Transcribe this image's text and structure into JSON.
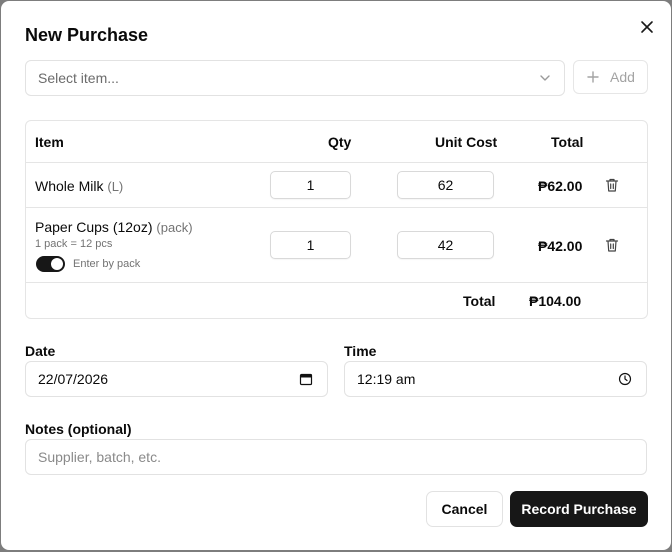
{
  "dialog": {
    "title": "New Purchase",
    "close_icon": "close-icon"
  },
  "item_select": {
    "placeholder": "Select item...",
    "add_label": "Add"
  },
  "table": {
    "headers": {
      "item": "Item",
      "qty": "Qty",
      "unit_cost": "Unit Cost",
      "total": "Total"
    },
    "rows": [
      {
        "name": "Whole Milk",
        "unit": "(L)",
        "qty": "1",
        "unit_cost": "62",
        "total": "₱62.00"
      },
      {
        "name": "Paper Cups (12oz)",
        "unit": "(pack)",
        "pack_info": "1 pack = 12 pcs",
        "toggle_label": "Enter by pack",
        "toggle_on": true,
        "qty": "1",
        "unit_cost": "42",
        "total": "₱42.00"
      }
    ],
    "footer": {
      "label": "Total",
      "value": "₱104.00"
    }
  },
  "date": {
    "label": "Date",
    "value": "22/07/2026"
  },
  "time": {
    "label": "Time",
    "value": "12:19 am"
  },
  "notes": {
    "label": "Notes (optional)",
    "placeholder": "Supplier, batch, etc."
  },
  "actions": {
    "cancel": "Cancel",
    "submit": "Record Purchase"
  },
  "colors": {
    "primary": "#171717",
    "border": "#e5e5e5",
    "muted": "#737373"
  }
}
